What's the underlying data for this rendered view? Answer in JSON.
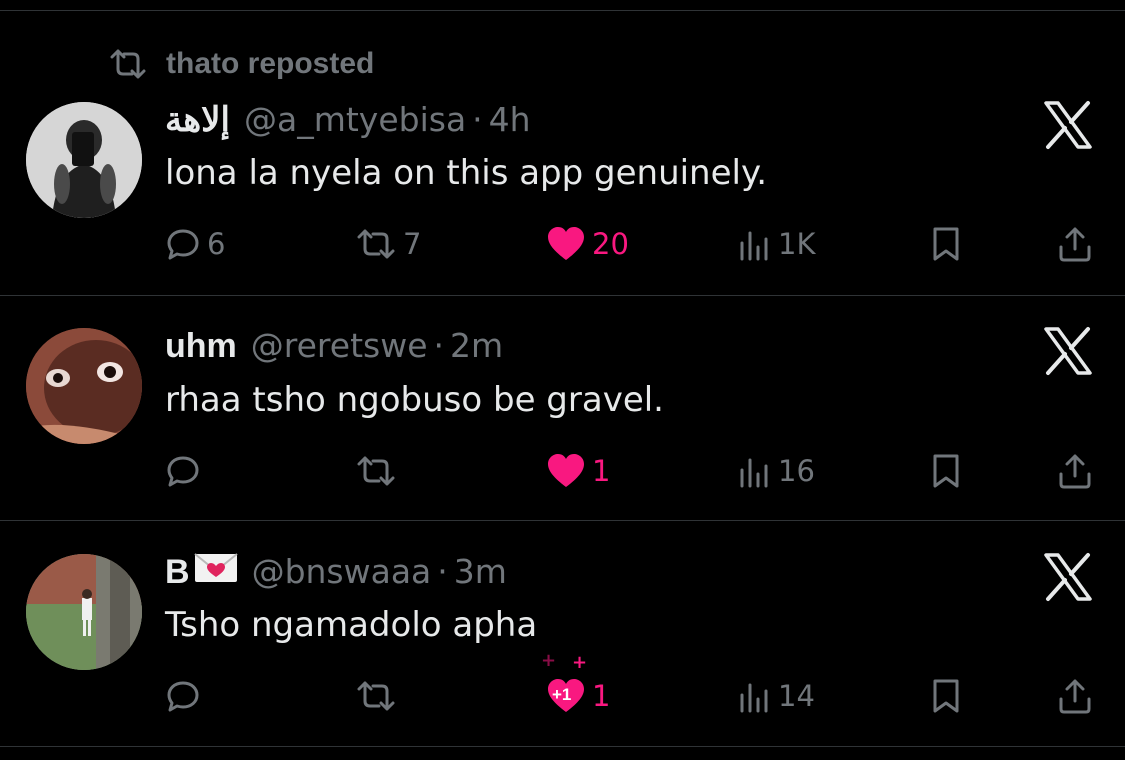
{
  "repost": {
    "label": "thato reposted"
  },
  "tweets": [
    {
      "name": "إلاهة",
      "handle": "@a_mtyebisa",
      "separator": "·",
      "time": "4h",
      "text": "lona la nyela on this app genuinely.",
      "replies": "6",
      "reposts": "7",
      "likes": "20",
      "liked": true,
      "views": "1K"
    },
    {
      "name": "uhm",
      "handle": "@reretswe",
      "separator": "·",
      "time": "2m",
      "text": "rhaa tsho ngobuso be gravel.",
      "replies": "",
      "reposts": "",
      "likes": "1",
      "liked": true,
      "views": "16"
    },
    {
      "name": "B",
      "name_emoji": "envelope-with-heart",
      "handle": "@bnswaaa",
      "separator": "·",
      "time": "3m",
      "text": "Tsho ngamadolo apha",
      "replies": "",
      "reposts": "",
      "likes": "1",
      "liked": true,
      "like_badge": "+1",
      "views": "14"
    }
  ],
  "colors": {
    "background": "#000000",
    "text": "#e7e9ea",
    "muted": "#71767b",
    "like": "#f91880",
    "divider": "#2f3336"
  },
  "icons": [
    "repost-icon",
    "reply-icon",
    "heart-icon",
    "views-icon",
    "bookmark-icon",
    "share-icon",
    "x-logo-icon"
  ]
}
